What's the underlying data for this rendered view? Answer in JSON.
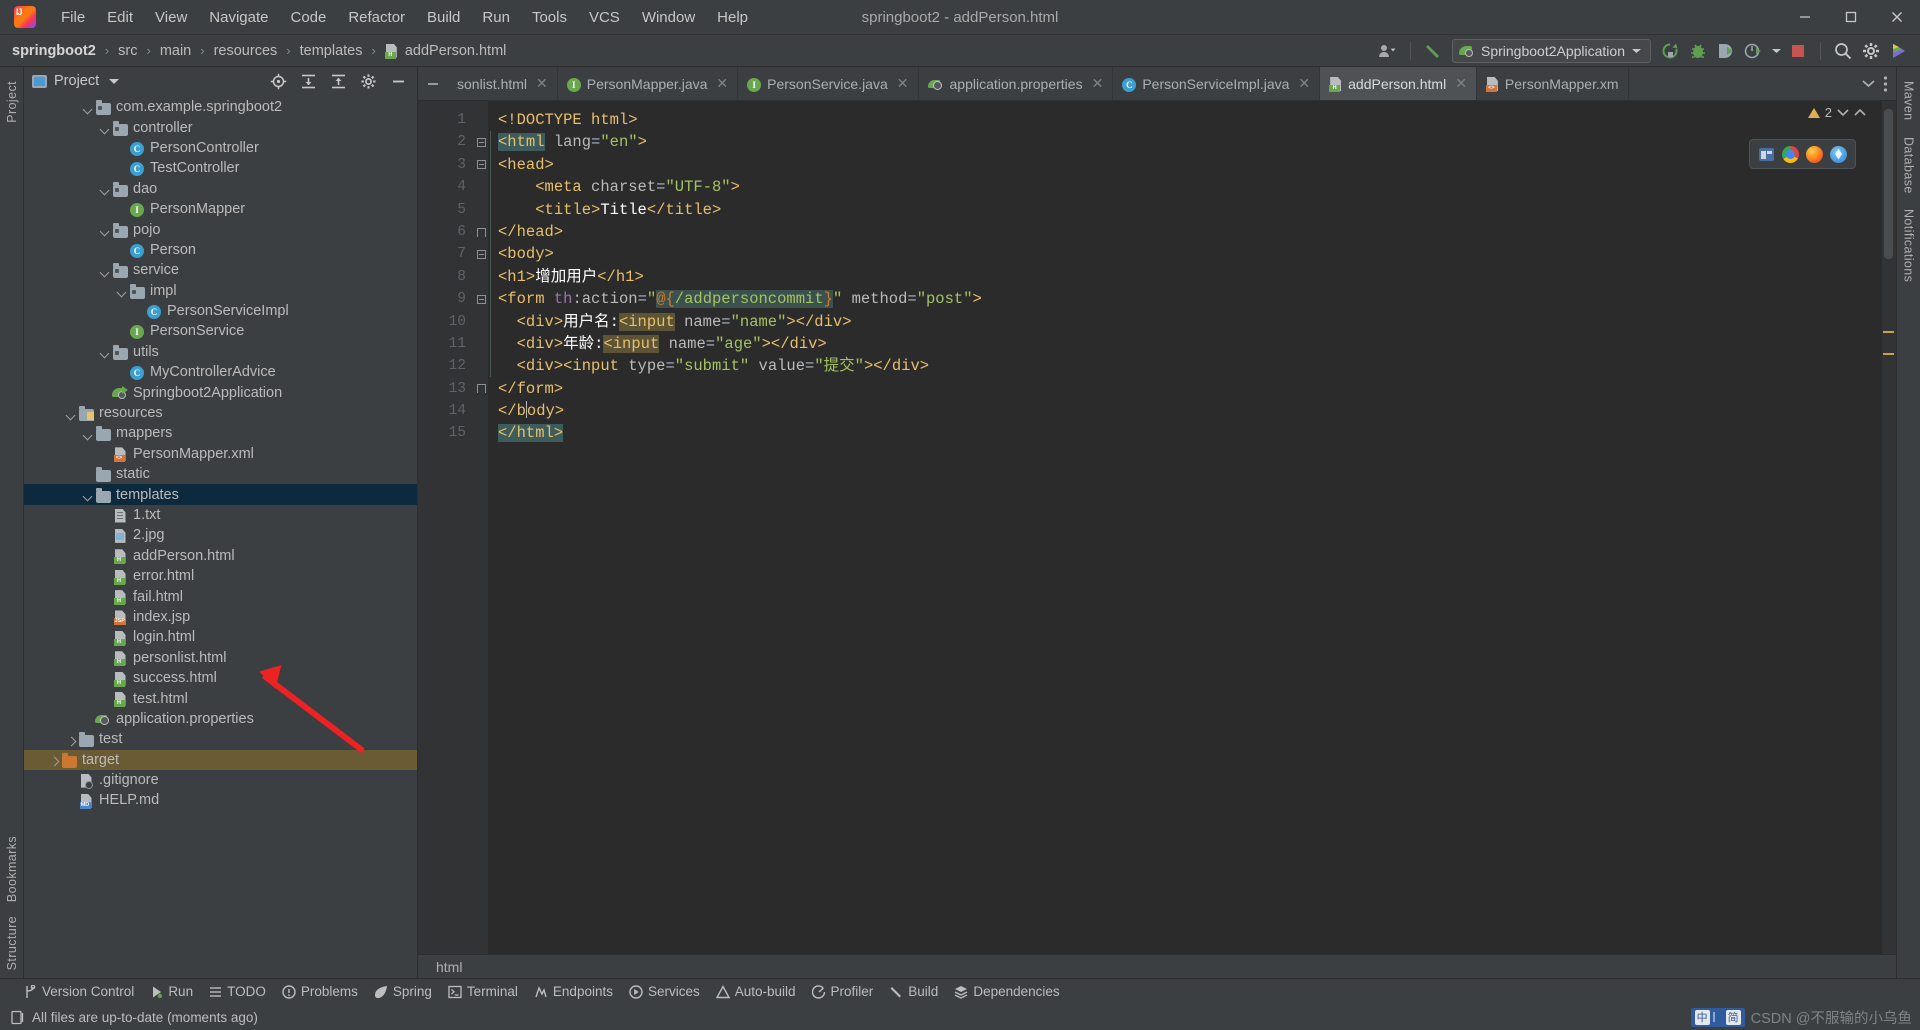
{
  "window": {
    "title": "springboot2 - addPerson.html",
    "minimize": "─",
    "maximize": "☐",
    "close": "✕"
  },
  "menu": {
    "items": [
      "File",
      "Edit",
      "View",
      "Navigate",
      "Code",
      "Refactor",
      "Build",
      "Run",
      "Tools",
      "VCS",
      "Window",
      "Help"
    ]
  },
  "breadcrumb": {
    "segments": [
      "springboot2",
      "src",
      "main",
      "resources",
      "templates",
      "addPerson.html"
    ],
    "separator": "›"
  },
  "toolbar": {
    "run_config_name": "Springboot2Application",
    "icons": [
      "user-dropdown-icon",
      "hammer-build-icon",
      "run-icon",
      "debug-icon",
      "run-with-coverage-icon",
      "profile-icon",
      "stop-icon",
      "search-everywhere-icon",
      "settings-gear-icon",
      "ai-assistant-icon"
    ]
  },
  "project_panel": {
    "title": "Project",
    "action_icons": [
      "locate-file-icon",
      "expand-all-icon",
      "collapse-all-icon",
      "panel-settings-icon",
      "hide-panel-icon"
    ],
    "tree": [
      {
        "label": "com.example.springboot2",
        "icon": "package-folder-icon",
        "indent": 4,
        "twisty": "open"
      },
      {
        "label": "controller",
        "icon": "package-folder-icon",
        "indent": 5,
        "twisty": "open"
      },
      {
        "label": "PersonController",
        "icon": "java-class-icon",
        "indent": 6,
        "twisty": "none"
      },
      {
        "label": "TestController",
        "icon": "java-class-icon",
        "indent": 6,
        "twisty": "none"
      },
      {
        "label": "dao",
        "icon": "package-folder-icon",
        "indent": 5,
        "twisty": "open"
      },
      {
        "label": "PersonMapper",
        "icon": "java-interface-icon",
        "indent": 6,
        "twisty": "none"
      },
      {
        "label": "pojo",
        "icon": "package-folder-icon",
        "indent": 5,
        "twisty": "open"
      },
      {
        "label": "Person",
        "icon": "java-class-icon",
        "indent": 6,
        "twisty": "none"
      },
      {
        "label": "service",
        "icon": "package-folder-icon",
        "indent": 5,
        "twisty": "open"
      },
      {
        "label": "impl",
        "icon": "package-folder-icon",
        "indent": 6,
        "twisty": "open"
      },
      {
        "label": "PersonServiceImpl",
        "icon": "java-class-icon",
        "indent": 7,
        "twisty": "none"
      },
      {
        "label": "PersonService",
        "icon": "java-interface-icon",
        "indent": 6,
        "twisty": "none"
      },
      {
        "label": "utils",
        "icon": "package-folder-icon",
        "indent": 5,
        "twisty": "open"
      },
      {
        "label": "MyControllerAdvice",
        "icon": "java-class-icon",
        "indent": 6,
        "twisty": "none"
      },
      {
        "label": "Springboot2Application",
        "icon": "spring-boot-app-icon",
        "indent": 5,
        "twisty": "none"
      },
      {
        "label": "resources",
        "icon": "resources-folder-icon",
        "indent": 3,
        "twisty": "open"
      },
      {
        "label": "mappers",
        "icon": "folder-icon",
        "indent": 4,
        "twisty": "open"
      },
      {
        "label": "PersonMapper.xml",
        "icon": "xml-file-icon",
        "indent": 5,
        "twisty": "none"
      },
      {
        "label": "static",
        "icon": "folder-icon",
        "indent": 4,
        "twisty": "none"
      },
      {
        "label": "templates",
        "icon": "folder-icon",
        "indent": 4,
        "twisty": "open",
        "selected": true
      },
      {
        "label": "1.txt",
        "icon": "text-file-icon",
        "indent": 5,
        "twisty": "none"
      },
      {
        "label": "2.jpg",
        "icon": "image-file-icon",
        "indent": 5,
        "twisty": "none"
      },
      {
        "label": "addPerson.html",
        "icon": "html-file-icon",
        "indent": 5,
        "twisty": "none",
        "annotated": true
      },
      {
        "label": "error.html",
        "icon": "html-file-icon",
        "indent": 5,
        "twisty": "none"
      },
      {
        "label": "fail.html",
        "icon": "html-file-icon",
        "indent": 5,
        "twisty": "none"
      },
      {
        "label": "index.jsp",
        "icon": "jsp-file-icon",
        "indent": 5,
        "twisty": "none"
      },
      {
        "label": "login.html",
        "icon": "html-file-icon",
        "indent": 5,
        "twisty": "none"
      },
      {
        "label": "personlist.html",
        "icon": "html-file-icon",
        "indent": 5,
        "twisty": "none"
      },
      {
        "label": "success.html",
        "icon": "html-file-icon",
        "indent": 5,
        "twisty": "none"
      },
      {
        "label": "test.html",
        "icon": "html-file-icon",
        "indent": 5,
        "twisty": "none"
      },
      {
        "label": "application.properties",
        "icon": "spring-properties-icon",
        "indent": 4,
        "twisty": "none"
      },
      {
        "label": "test",
        "icon": "folder-icon",
        "indent": 3,
        "twisty": "closed"
      },
      {
        "label": "target",
        "icon": "target-folder-icon",
        "indent": 2,
        "twisty": "closed",
        "highlighted": true
      },
      {
        "label": ".gitignore",
        "icon": "gitignore-file-icon",
        "indent": 3,
        "twisty": "none"
      },
      {
        "label": "HELP.md",
        "icon": "markdown-file-icon",
        "indent": 3,
        "twisty": "none"
      }
    ]
  },
  "left_strip": {
    "labels": [
      "Project",
      "Bookmarks",
      "Structure"
    ]
  },
  "right_strip": {
    "labels": [
      "Maven",
      "Database",
      "Notifications"
    ]
  },
  "editor": {
    "tabs": [
      {
        "label": "sonlist.html",
        "icon": "html-file-icon",
        "active": false,
        "truncated": true
      },
      {
        "label": "PersonMapper.java",
        "icon": "java-interface-icon",
        "active": false
      },
      {
        "label": "PersonService.java",
        "icon": "java-interface-icon",
        "active": false
      },
      {
        "label": "application.properties",
        "icon": "spring-properties-icon",
        "active": false
      },
      {
        "label": "PersonServiceImpl.java",
        "icon": "java-class-icon",
        "active": false
      },
      {
        "label": "addPerson.html",
        "icon": "html-file-icon",
        "active": true
      },
      {
        "label": "PersonMapper.xm",
        "icon": "xml-file-icon",
        "active": false,
        "truncated": true
      }
    ],
    "tab_overflow_icon": "chevron-down-icon",
    "tab_menu_icon": "more-vertical-icon",
    "line_numbers": [
      1,
      2,
      3,
      4,
      5,
      6,
      7,
      8,
      9,
      10,
      11,
      12,
      13,
      14,
      15
    ],
    "lines": [
      "<!DOCTYPE html>",
      "<html lang=\"en\">",
      "<head>",
      "    <meta charset=\"UTF-8\">",
      "    <title>Title</title>",
      "</head>",
      "<body>",
      "<h1>增加用户</h1>",
      "<form th:action=\"@{/addpersoncommit}\" method=\"post\">",
      "    <div>用户名:<input name=\"name\"></div>",
      "    <div>年龄:<input name=\"age\"></div>",
      "    <div><input type=\"submit\" value=\"提交\"></div>",
      "</form>",
      "</body>",
      "</html>"
    ],
    "inspection_warning_count": "2",
    "breadcrumb_status": "html",
    "browser_icons": [
      "ide-browser-icon",
      "chrome-icon",
      "firefox-icon",
      "safari-icon",
      "edge-icon"
    ]
  },
  "tool_windows": {
    "items": [
      {
        "label": "Version Control",
        "icon": "branch-icon"
      },
      {
        "label": "Run",
        "icon": "run-icon"
      },
      {
        "label": "TODO",
        "icon": "todo-list-icon"
      },
      {
        "label": "Problems",
        "icon": "problems-icon"
      },
      {
        "label": "Spring",
        "icon": "spring-leaf-icon"
      },
      {
        "label": "Terminal",
        "icon": "terminal-icon"
      },
      {
        "label": "Endpoints",
        "icon": "endpoints-icon"
      },
      {
        "label": "Services",
        "icon": "services-icon"
      },
      {
        "label": "Auto-build",
        "icon": "auto-build-icon"
      },
      {
        "label": "Profiler",
        "icon": "profiler-icon"
      },
      {
        "label": "Build",
        "icon": "hammer-build-icon"
      },
      {
        "label": "Dependencies",
        "icon": "dependencies-icon"
      }
    ]
  },
  "status_bar": {
    "message": "All files are up-to-date (moments ago)",
    "message_icon": "sync-status-icon",
    "ime_label": "中",
    "ime_secondary": "简",
    "watermark": "CSDN @不服输的小乌鱼"
  },
  "colors": {
    "bg_panel": "#3c3f41",
    "bg_editor": "#2b2b2b",
    "bg_gutter": "#313335",
    "selection": "#0d293e",
    "accent_green": "#6aa84f",
    "accent_orange": "#cc7832",
    "annotation_arrow": "#ee2222"
  }
}
